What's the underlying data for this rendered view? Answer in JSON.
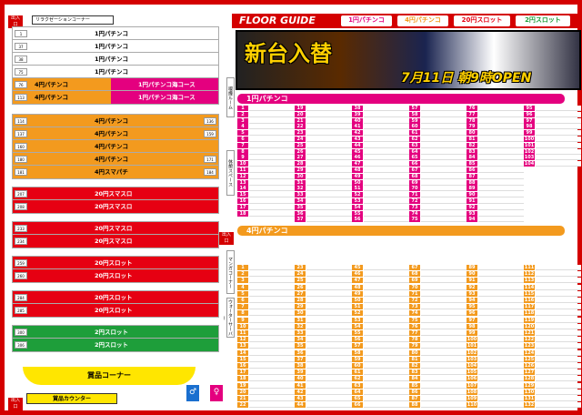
{
  "header": {
    "title": "FLOOR GUIDE",
    "tabs": [
      {
        "label": "1円パチンコ",
        "color": "#e4007f"
      },
      {
        "label": "4円パチンコ",
        "color": "#f39a1e"
      },
      {
        "label": "20円スロット",
        "color": "#e60012"
      },
      {
        "label": "2円スロット",
        "color": "#1e9e3a"
      }
    ]
  },
  "banner": {
    "main": "新台入替",
    "date": "7月11日 朝9時OPEN"
  },
  "floor": {
    "lounge": "リラクゼーションコーナー",
    "entrance": "出入口",
    "smoking_room": "喫煙ルーム",
    "rest_space": "休憩スペース",
    "manga": "マンガコーナー",
    "water": "ウォーターサーバー",
    "prize": "賞品コーナー",
    "prize_counter": "賞品カウンター",
    "lanes": [
      {
        "type": "w",
        "label": "1円パチンコ",
        "l": "1",
        "r": ""
      },
      {
        "type": "w",
        "label": "1円パチンコ",
        "l": "37",
        "r": ""
      },
      {
        "type": "w",
        "label": "1円パチンコ",
        "l": "38",
        "r": ""
      },
      {
        "type": "w",
        "label": "1円パチンコ",
        "l": "75",
        "r": ""
      },
      {
        "type": "o",
        "label": "4円パチンコ",
        "pink": "1円パチンコ海コース",
        "l": "76",
        "r": ""
      },
      {
        "type": "o",
        "label": "4円パチンコ",
        "pink": "1円パチンコ海コース",
        "l": "113",
        "r": ""
      },
      {
        "type": "o",
        "label": "4円パチンコ",
        "l": "114",
        "r": "136"
      },
      {
        "type": "o",
        "label": "4円パチンコ",
        "l": "137",
        "r": "159"
      },
      {
        "type": "o",
        "label": "4円パチンコ",
        "l": "160",
        "r": ""
      },
      {
        "type": "o",
        "label": "4円パチンコ",
        "l": "180",
        "r": "171"
      },
      {
        "type": "o",
        "label": "4円スマパチ",
        "l": "181",
        "r": "184"
      },
      {
        "type": "r",
        "label": "20円スマスロ",
        "l": "207",
        "r": ""
      },
      {
        "type": "r",
        "label": "20円スマスロ",
        "l": "208",
        "r": ""
      },
      {
        "type": "r",
        "label": "20円スマスロ",
        "l": "233",
        "r": ""
      },
      {
        "type": "r",
        "label": "20円スマスロ",
        "l": "234",
        "r": ""
      },
      {
        "type": "r",
        "label": "20円スロット",
        "l": "259",
        "r": ""
      },
      {
        "type": "r",
        "label": "20円スロット",
        "l": "260",
        "r": ""
      },
      {
        "type": "r",
        "label": "20円スロット",
        "l": "284",
        "r": ""
      },
      {
        "type": "r",
        "label": "20円スロット",
        "l": "285",
        "r": ""
      },
      {
        "type": "g",
        "label": "2円スロット",
        "l": "300",
        "r": ""
      },
      {
        "type": "g",
        "label": "2円スロット",
        "l": "306",
        "r": ""
      }
    ]
  },
  "sections": {
    "one_yen": {
      "label": "1円パチンコ",
      "color": "#e4007f"
    },
    "four_yen": {
      "label": "4円パチンコ",
      "color": "#f39a1e"
    }
  },
  "one_yen_cols": [
    {
      "start": 1,
      "count": 18
    },
    {
      "start": 19,
      "count": 19
    },
    {
      "start": 38,
      "count": 19
    },
    {
      "start": 57,
      "count": 19
    },
    {
      "start": 76,
      "count": 19
    },
    {
      "start": 95,
      "count": 10
    }
  ],
  "four_yen_cols": [
    {
      "start": 1,
      "count": 22
    },
    {
      "start": 23,
      "count": 22
    },
    {
      "start": 45,
      "count": 22
    },
    {
      "start": 67,
      "count": 22
    },
    {
      "start": 89,
      "count": 22
    },
    {
      "start": 111,
      "count": 22
    }
  ]
}
